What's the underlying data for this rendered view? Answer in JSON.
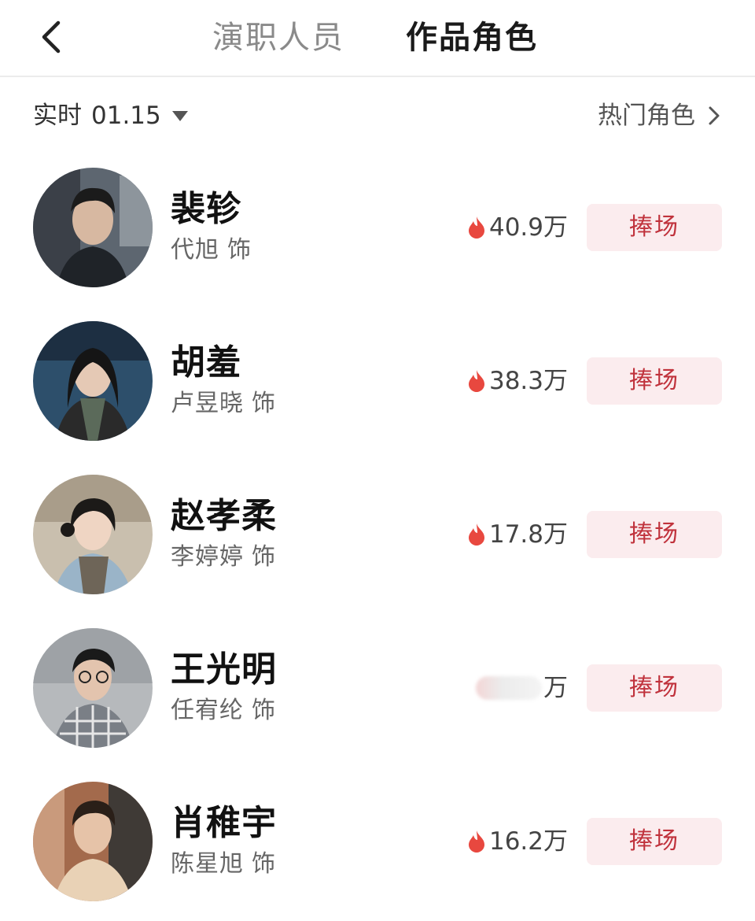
{
  "header": {
    "tabs": [
      {
        "label": "演职人员",
        "active": false
      },
      {
        "label": "作品角色",
        "active": true
      }
    ]
  },
  "filter": {
    "time_label": "实时",
    "date": "01.15",
    "hot_roles_label": "热门角色"
  },
  "roles": [
    {
      "name": "裴轸",
      "actor": "代旭",
      "suffix": "饰",
      "heat": "40.9万",
      "button": "捧场"
    },
    {
      "name": "胡羞",
      "actor": "卢昱晓",
      "suffix": "饰",
      "heat": "38.3万",
      "button": "捧场"
    },
    {
      "name": "赵孝柔",
      "actor": "李婷婷",
      "suffix": "饰",
      "heat": "17.8万",
      "button": "捧场"
    },
    {
      "name": "王光明",
      "actor": "任宥纶",
      "suffix": "饰",
      "heat": "万",
      "button": "捧场"
    },
    {
      "name": "肖稚宇",
      "actor": "陈星旭",
      "suffix": "饰",
      "heat": "16.2万",
      "button": "捧场"
    }
  ],
  "colors": {
    "accent": "#c0323c",
    "button_bg": "#fbecee",
    "flame": "#e8483f"
  }
}
